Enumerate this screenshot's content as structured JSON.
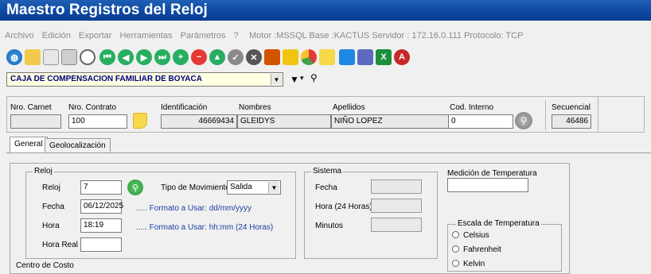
{
  "window": {
    "title": "Maestro Registros del Reloj"
  },
  "menu": {
    "items": [
      "Archivo",
      "Edición",
      "Exportar",
      "Herramientas",
      "Parámetros",
      "?"
    ],
    "status": "Motor :MSSQL  Base :KACTUS  Servidor : 172.16.0.111    Protocolo: TCP"
  },
  "company_select": {
    "value": "CAJA DE COMPENSACION FAMILIAR DE BOYACA"
  },
  "header": {
    "carnet_label": "Nro. Carnet",
    "carnet_value": "",
    "contrato_label": "Nro. Contrato",
    "contrato_value": "100",
    "identificacion_label": "Identificación",
    "identificacion_value": "46669434",
    "nombres_label": "Nombres",
    "nombres_value": "GLEIDYS",
    "apellidos_label": "Apellidos",
    "apellidos_value": "NIÑO LOPEZ",
    "cod_interno_label": "Cod. Interno",
    "cod_interno_value": "0",
    "secuencial_label": "Secuencial",
    "secuencial_value": "46486"
  },
  "tabs": [
    {
      "label": "General"
    },
    {
      "label": "Geolocalización"
    }
  ],
  "reloj": {
    "group_title": "Reloj",
    "reloj_label": "Reloj",
    "reloj_value": "7",
    "tipo_label": "Tipo de Movimiento",
    "tipo_value": "Salida",
    "fecha_label": "Fecha",
    "fecha_value": "06/12/2025",
    "fecha_hint": "..... Formato a Usar:  dd/mm/yyyy",
    "hora_label": "Hora",
    "hora_value": "18:19",
    "hora_hint": "..... Formato a Usar:  hh:mm (24 Horas)",
    "hora_real_label": "Hora Real",
    "hora_real_value": ""
  },
  "sistema": {
    "group_title": "Sistema",
    "fecha_label": "Fecha",
    "hora_label": "Hora (24 Horas)",
    "minutos_label": "Minutos"
  },
  "temperatura": {
    "medicion_label": "Medición de Temperatura",
    "medicion_value": "",
    "escala_title": "Escala de Temperatura",
    "options": [
      "Celsius",
      "Fahrenheit",
      "Kelvin"
    ]
  },
  "centro_costo_label": "Centro de Costo",
  "colors": {
    "title_bar": "#0d47a1",
    "combo_bg": "#ffffe1",
    "hint": "#1a3fa0",
    "green": "#2a9a3c"
  },
  "toolbar_icons": [
    "world-icon",
    "folder-icon",
    "copy-icon",
    "print-icon",
    "preview-icon",
    "first-icon",
    "prev-icon",
    "next-icon",
    "last-icon",
    "add-icon",
    "remove-icon",
    "up-icon",
    "accept-icon",
    "cancel-icon",
    "chart-icon",
    "edit-icon",
    "pie-icon",
    "note-icon",
    "calc-icon",
    "excel-icon",
    "excel2-icon",
    "access-icon"
  ]
}
